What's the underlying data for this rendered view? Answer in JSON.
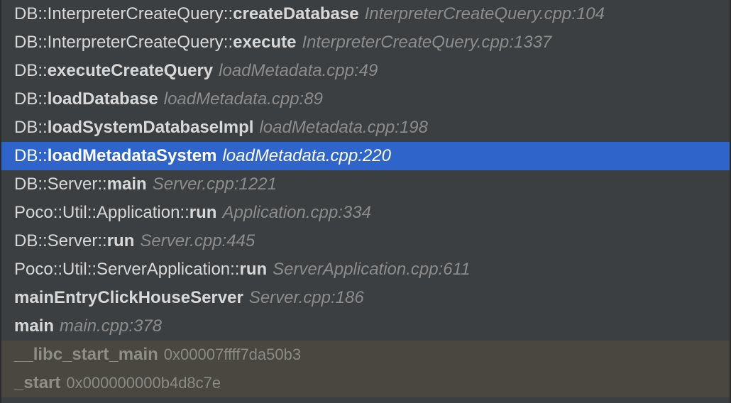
{
  "frames": [
    {
      "ns": "DB::InterpreterCreateQuery::",
      "fn": "createDatabase",
      "loc": "InterpreterCreateQuery.cpp:104",
      "kind": "normal"
    },
    {
      "ns": "DB::InterpreterCreateQuery::",
      "fn": "execute",
      "loc": "InterpreterCreateQuery.cpp:1337",
      "kind": "normal"
    },
    {
      "ns": "DB::",
      "fn": "executeCreateQuery",
      "loc": "loadMetadata.cpp:49",
      "kind": "normal"
    },
    {
      "ns": "DB::",
      "fn": "loadDatabase",
      "loc": "loadMetadata.cpp:89",
      "kind": "normal"
    },
    {
      "ns": "DB::",
      "fn": "loadSystemDatabaseImpl",
      "loc": "loadMetadata.cpp:198",
      "kind": "normal"
    },
    {
      "ns": "DB::",
      "fn": "loadMetadataSystem",
      "loc": "loadMetadata.cpp:220",
      "kind": "selected"
    },
    {
      "ns": "DB::Server::",
      "fn": "main",
      "loc": "Server.cpp:1221",
      "kind": "normal"
    },
    {
      "ns": "Poco::Util::Application::",
      "fn": "run",
      "loc": "Application.cpp:334",
      "kind": "normal"
    },
    {
      "ns": "DB::Server::",
      "fn": "run",
      "loc": "Server.cpp:445",
      "kind": "normal"
    },
    {
      "ns": "Poco::Util::ServerApplication::",
      "fn": "run",
      "loc": "ServerApplication.cpp:611",
      "kind": "normal"
    },
    {
      "ns": "",
      "fn": "mainEntryClickHouseServer",
      "loc": "Server.cpp:186",
      "kind": "normal"
    },
    {
      "ns": "",
      "fn": "main",
      "loc": "main.cpp:378",
      "kind": "normal"
    },
    {
      "ns": "",
      "fn": "__libc_start_main",
      "addr": "0x00007ffff7da50b3",
      "kind": "library"
    },
    {
      "ns": "",
      "fn": "_start",
      "addr": "0x000000000b4d8c7e",
      "kind": "library"
    }
  ],
  "colors": {
    "background": "#3c3f41",
    "selected": "#2f65ca",
    "library": "#4a4740"
  }
}
